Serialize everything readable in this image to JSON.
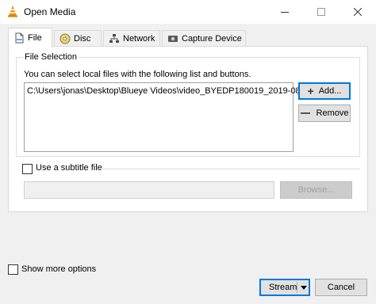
{
  "window": {
    "title": "Open Media",
    "app_icon": "vlc-cone-icon",
    "controls": [
      "minimize-icon",
      "maximize-icon",
      "close-icon"
    ]
  },
  "tabs": [
    {
      "label": "File",
      "icon": "file-icon",
      "active": true
    },
    {
      "label": "Disc",
      "icon": "disc-icon",
      "active": false
    },
    {
      "label": "Network",
      "icon": "network-icon",
      "active": false
    },
    {
      "label": "Capture Device",
      "icon": "capture-device-icon",
      "active": false
    }
  ],
  "file_selection": {
    "group_title": "File Selection",
    "description": "You can select local files with the following list and buttons.",
    "files": [
      "C:\\Users\\jonas\\Desktop\\Blueye Videos\\video_BYEDP180019_2019-08..."
    ],
    "add_label": "Add...",
    "remove_label": "Remove"
  },
  "subtitle": {
    "checkbox_label": "Use a subtitle file",
    "checked": false,
    "path_value": "",
    "browse_label": "Browse..."
  },
  "footer": {
    "more_options_label": "Show more options",
    "more_options_checked": false,
    "stream_label": "Stream",
    "cancel_label": "Cancel"
  },
  "colors": {
    "accent": "#0078d7",
    "vlc_orange": "#f48b00"
  }
}
